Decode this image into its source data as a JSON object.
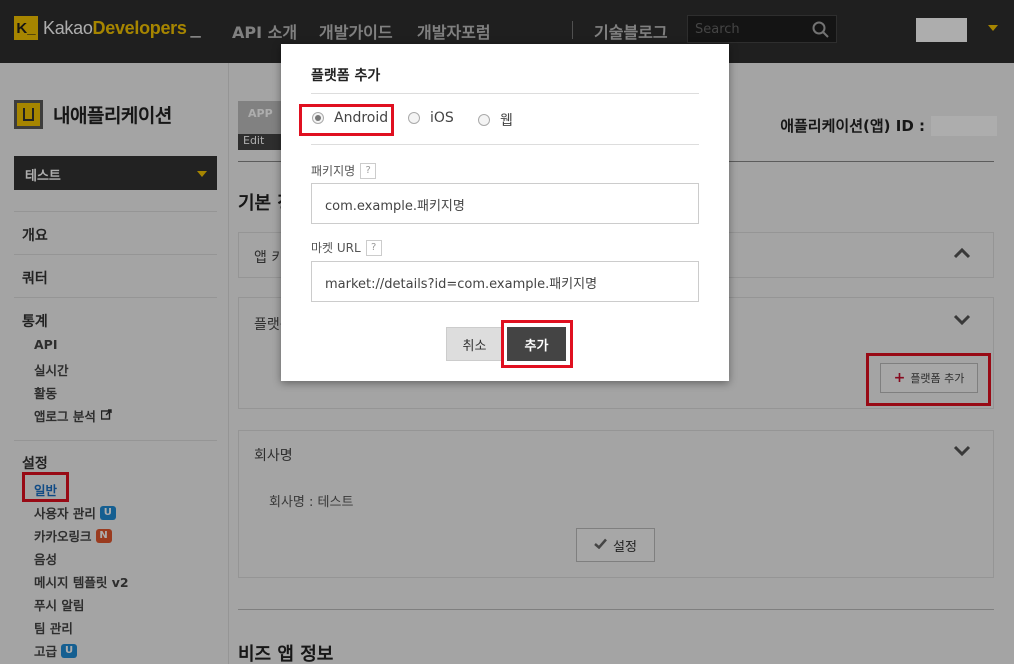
{
  "header": {
    "logo_k": "K_",
    "logo_kakao": "Kakao",
    "logo_developers": "Developers",
    "logo_cursor": "_",
    "nav": [
      "API 소개",
      "개발가이드",
      "개발자포럼",
      "기술블로그"
    ],
    "search_placeholder": "Search"
  },
  "sidebar": {
    "title": "내애플리케이션",
    "selected_app": "테스트",
    "sections": {
      "overview": "개요",
      "quota": "쿼터",
      "stats": "통계",
      "settings": "설정"
    },
    "stats_items": [
      "API",
      "실시간",
      "활동",
      "앱로그 분석"
    ],
    "settings_items": [
      {
        "label": "일반"
      },
      {
        "label": "사용자 관리",
        "badge": "U"
      },
      {
        "label": "카카오링크",
        "badge": "N"
      },
      {
        "label": "음성"
      },
      {
        "label": "메시지 템플릿 v2"
      },
      {
        "label": "푸시 알림"
      },
      {
        "label": "팀 관리"
      },
      {
        "label": "고급",
        "badge": "U"
      }
    ]
  },
  "main": {
    "app_image_label": "APP",
    "app_image_edit": "Edit",
    "app_id_label": "애플리케이션(앱) ID :",
    "basic_title": "기본 정보",
    "panel_app": "앱 키",
    "panel_platform": "플랫폼",
    "add_platform_button": "플랫폼 추가",
    "company_title": "회사명",
    "company_label": "회사명 :  테스트",
    "set_button": "설정",
    "biz_title": "비즈 앱 정보"
  },
  "modal": {
    "title": "플랫폼 추가",
    "options": [
      "Android",
      "iOS",
      "웹"
    ],
    "selected_option": "Android",
    "package_label": "패키지명",
    "package_value": "com.example.패키지명",
    "market_label": "마켓 URL",
    "market_value": "market://details?id=com.example.패키지명",
    "cancel": "취소",
    "add": "추가",
    "help": "?"
  },
  "colors": {
    "accent": "#f5c400",
    "highlight": "#e01020",
    "link_active": "#1a6fc4"
  }
}
